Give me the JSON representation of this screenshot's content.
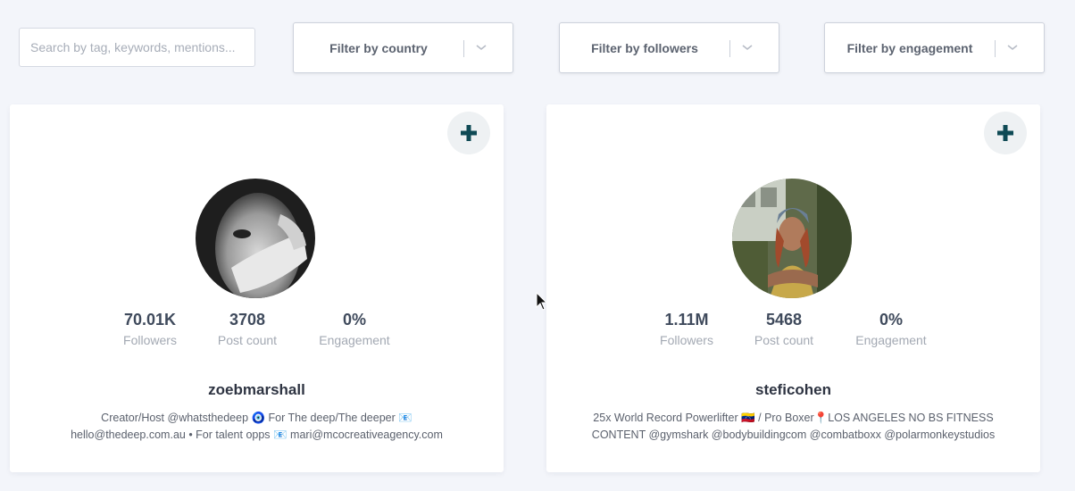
{
  "search": {
    "placeholder": "Search by tag, keywords, mentions...",
    "value": ""
  },
  "filters": [
    {
      "label": "Filter by country",
      "icon": "chevron-down-icon"
    },
    {
      "label": "Filter by followers",
      "icon": "chevron-down-icon"
    },
    {
      "label": "Filter by engagement",
      "icon": "chevron-down-icon"
    }
  ],
  "cards": [
    {
      "username": "zoebmarshall",
      "followers": "70.01K",
      "followers_label": "Followers",
      "post_count": "3708",
      "post_count_label": "Post count",
      "engagement": "0%",
      "engagement_label": "Engagement",
      "bio_line1": "Creator/Host @whatsthedeep 🧿 For The deep/The deeper 📧",
      "bio_line2": "hello@thedeep.com.au • For talent opps 📧 mari@mcocreativeagency.com",
      "add_icon": "plus-icon"
    },
    {
      "username": "steficohen",
      "followers": "1.11M",
      "followers_label": "Followers",
      "post_count": "5468",
      "post_count_label": "Post count",
      "engagement": "0%",
      "engagement_label": "Engagement",
      "bio_line1": "25x World Record Powerlifter 🇻🇪 / Pro Boxer📍LOS ANGELES NO BS FITNESS",
      "bio_line2": "CONTENT @gymshark @bodybuildingcom @combatboxx @polarmonkeystudios",
      "add_icon": "plus-icon"
    }
  ],
  "colors": {
    "page_bg": "#f3f5fa",
    "accent": "#0f4a55",
    "stat_value": "#3f4a5c",
    "stat_label": "#a3a9b3"
  }
}
